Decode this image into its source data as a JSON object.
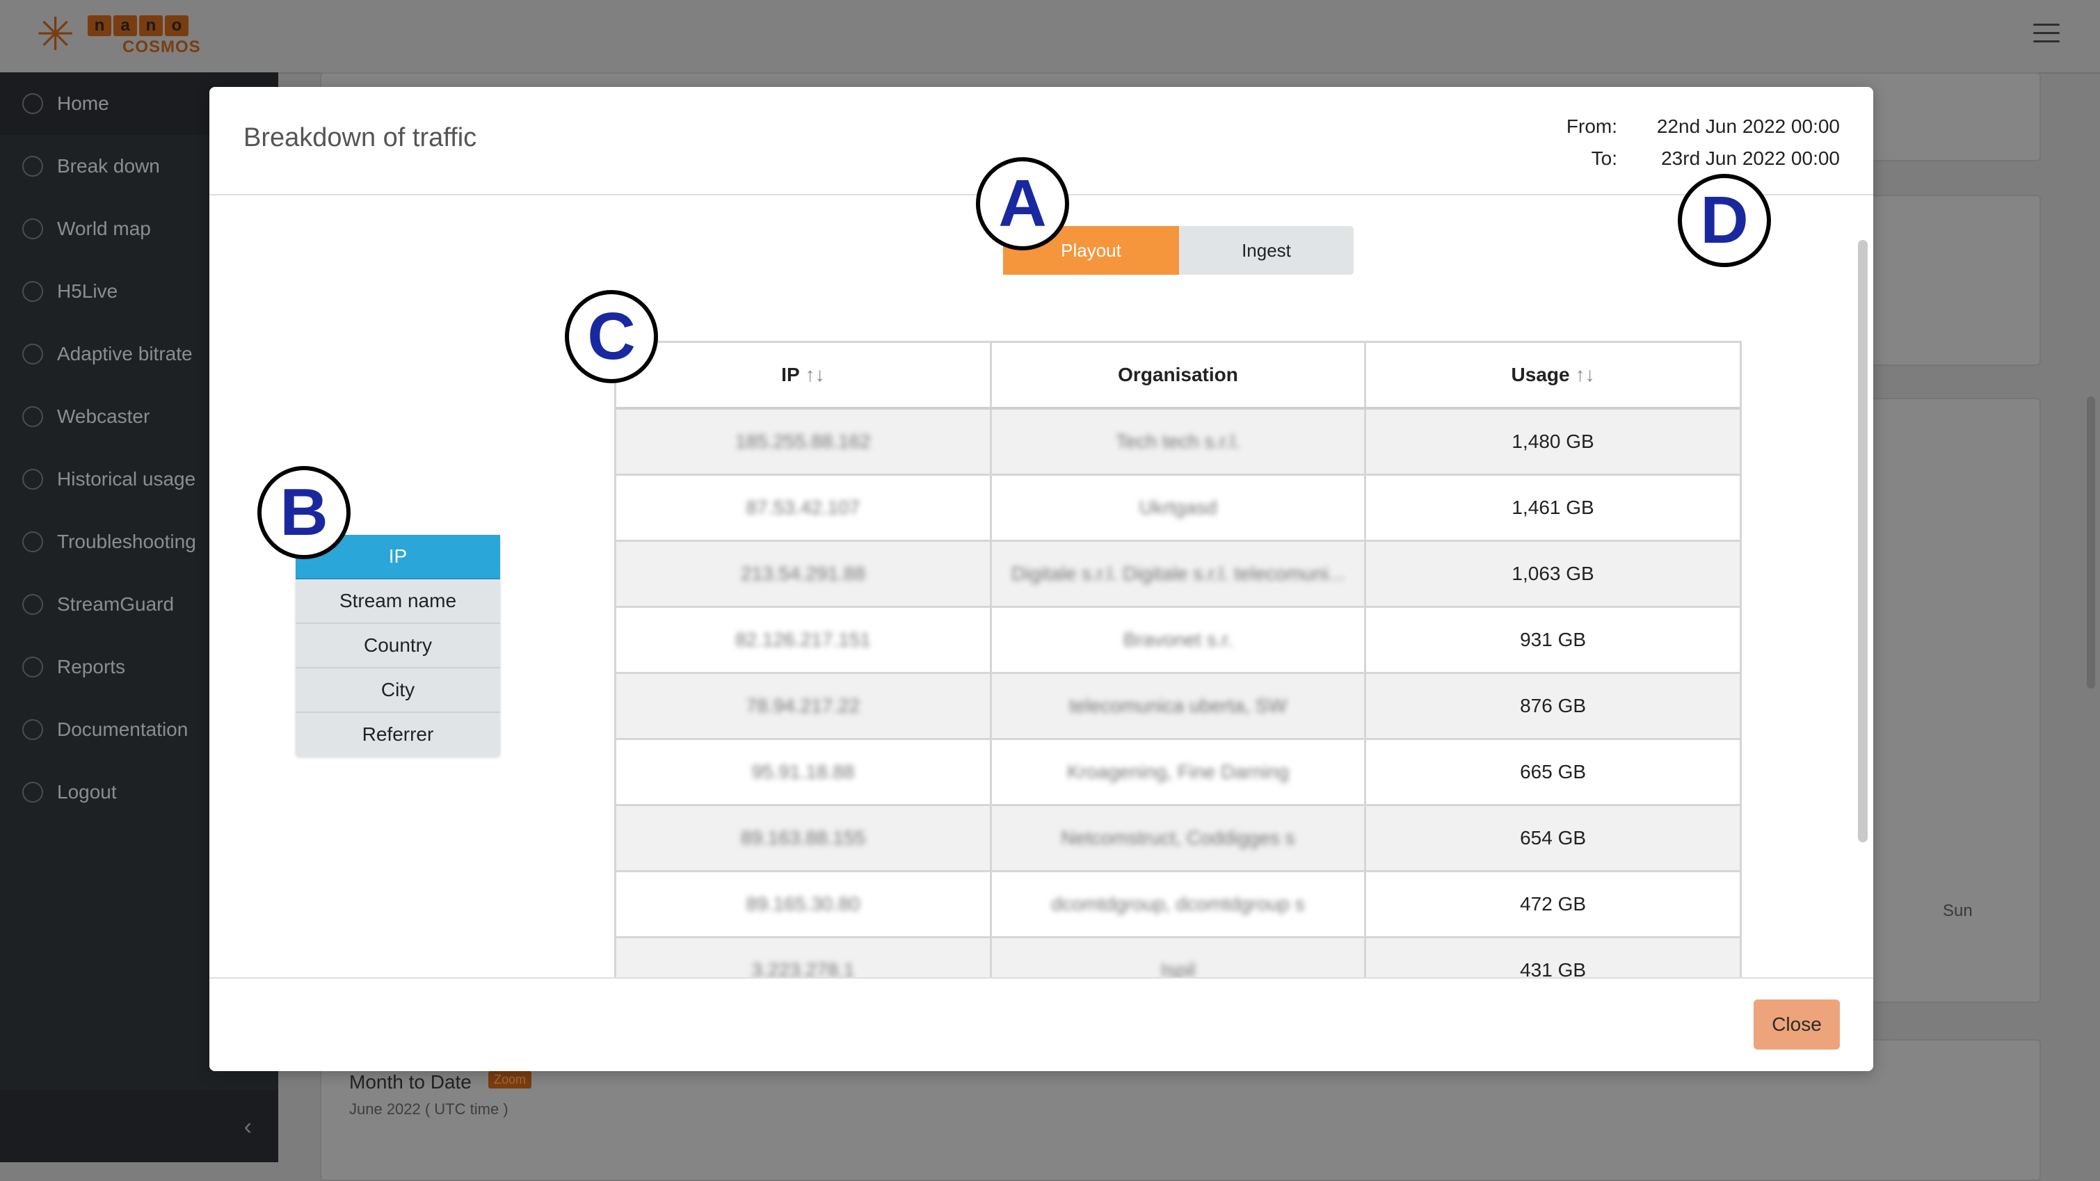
{
  "app": {
    "logo_letters": [
      "n",
      "a",
      "n",
      "o"
    ],
    "logo_sub": "COSMOS"
  },
  "sidebar": {
    "items": [
      {
        "label": "Home",
        "icon": "dashboard-icon"
      },
      {
        "label": "Break down",
        "icon": "dashboard-icon"
      },
      {
        "label": "World map",
        "icon": "dashboard-icon"
      },
      {
        "label": "H5Live",
        "icon": "dashboard-icon"
      },
      {
        "label": "Adaptive bitrate",
        "icon": "gauge-icon"
      },
      {
        "label": "Webcaster",
        "icon": "dashboard-icon"
      },
      {
        "label": "Historical usage",
        "icon": "clock-icon"
      },
      {
        "label": "Troubleshooting",
        "icon": "tools-icon"
      },
      {
        "label": "StreamGuard",
        "icon": "tools-icon"
      },
      {
        "label": "Reports",
        "icon": "file-icon"
      },
      {
        "label": "Documentation",
        "icon": "book-icon"
      },
      {
        "label": "Logout",
        "icon": "logout-icon"
      }
    ]
  },
  "background": {
    "chart_day": "Sun",
    "month_title": "Month to Date",
    "zoom_badge": "Zoom",
    "month_sub": "June 2022    ( UTC time )"
  },
  "modal": {
    "title": "Breakdown of traffic",
    "from_label": "From:",
    "from_value": "22nd Jun 2022 00:00",
    "to_label": "To:",
    "to_value": "23rd Jun 2022 00:00",
    "tabs": [
      {
        "label": "Playout",
        "active": true
      },
      {
        "label": "Ingest",
        "active": false
      }
    ],
    "group_by": [
      {
        "label": "IP",
        "active": true
      },
      {
        "label": "Stream name",
        "active": false
      },
      {
        "label": "Country",
        "active": false
      },
      {
        "label": "City",
        "active": false
      },
      {
        "label": "Referrer",
        "active": false
      }
    ],
    "table": {
      "headers": [
        "IP",
        "Organisation",
        "Usage"
      ],
      "sort_glyph": "↑↓",
      "rows": [
        {
          "ip": "185.255.88.162",
          "org": "Tech tech s.r.l.",
          "usage": "1,480 GB"
        },
        {
          "ip": "87.53.42.107",
          "org": "Ukrtgasd",
          "usage": "1,461 GB"
        },
        {
          "ip": "213.54.291.88",
          "org": "Digitale s.r.l. Digitale s.r.l. telecomuni...",
          "usage": "1,063 GB"
        },
        {
          "ip": "82.126.217.151",
          "org": "Bravonet s.r.",
          "usage": "931 GB"
        },
        {
          "ip": "78.94.217.22",
          "org": "telecomunica uberta, SW",
          "usage": "876 GB"
        },
        {
          "ip": "95.91.18.88",
          "org": "Kroagening, Fine Darning",
          "usage": "665 GB"
        },
        {
          "ip": "89.163.88.155",
          "org": "Netcomstruct, Coddigges s",
          "usage": "654 GB"
        },
        {
          "ip": "89.165.30.80",
          "org": "dcomtdgroup, dcomtdgroup s",
          "usage": "472 GB"
        },
        {
          "ip": "3.223.278.1",
          "org": "Ispil",
          "usage": "431 GB"
        }
      ]
    },
    "close_label": "Close"
  },
  "markers": {
    "a": "A",
    "b": "B",
    "c": "C",
    "d": "D"
  },
  "colors": {
    "accent_orange": "#f5953c",
    "active_blue": "#2aa6d8",
    "marker_text": "#1a28a0",
    "close_button": "#eda47a"
  }
}
